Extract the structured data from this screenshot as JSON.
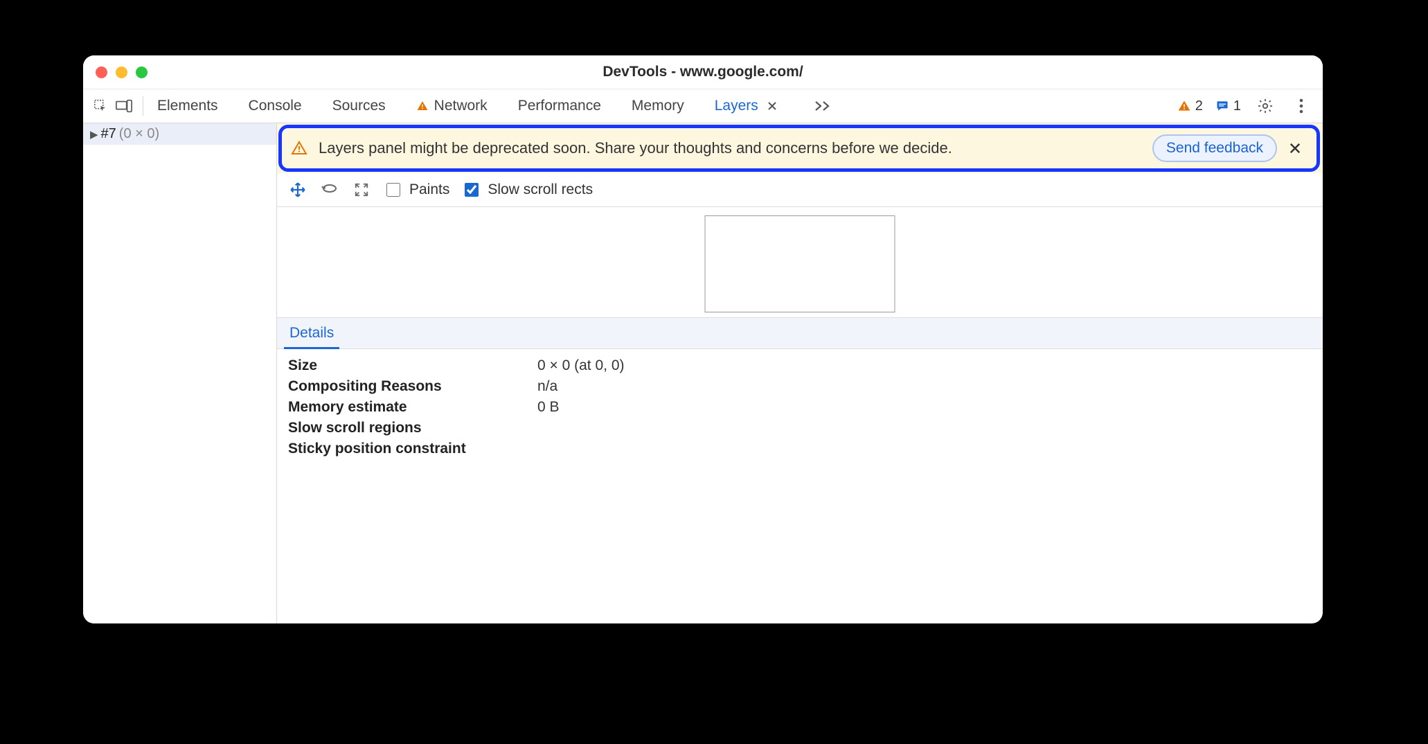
{
  "title": "DevTools - www.google.com/",
  "tabs": {
    "elements": "Elements",
    "console": "Console",
    "sources": "Sources",
    "network": "Network",
    "performance": "Performance",
    "memory": "Memory",
    "layers": "Layers"
  },
  "counters": {
    "issues": "2",
    "messages": "1"
  },
  "tree": {
    "item_id": "#7",
    "item_dim": "(0 × 0)"
  },
  "banner": {
    "message": "Layers panel might be deprecated soon. Share your thoughts and concerns before we decide.",
    "feedback": "Send feedback"
  },
  "subbar": {
    "paints_label": "Paints",
    "slow_scroll_label": "Slow scroll rects"
  },
  "details": {
    "tab_label": "Details",
    "rows": {
      "size_k": "Size",
      "size_v": "0 × 0 (at 0, 0)",
      "comp_k": "Compositing Reasons",
      "comp_v": "n/a",
      "mem_k": "Memory estimate",
      "mem_v": "0 B",
      "slow_k": "Slow scroll regions",
      "slow_v": "",
      "sticky_k": "Sticky position constraint",
      "sticky_v": ""
    }
  }
}
